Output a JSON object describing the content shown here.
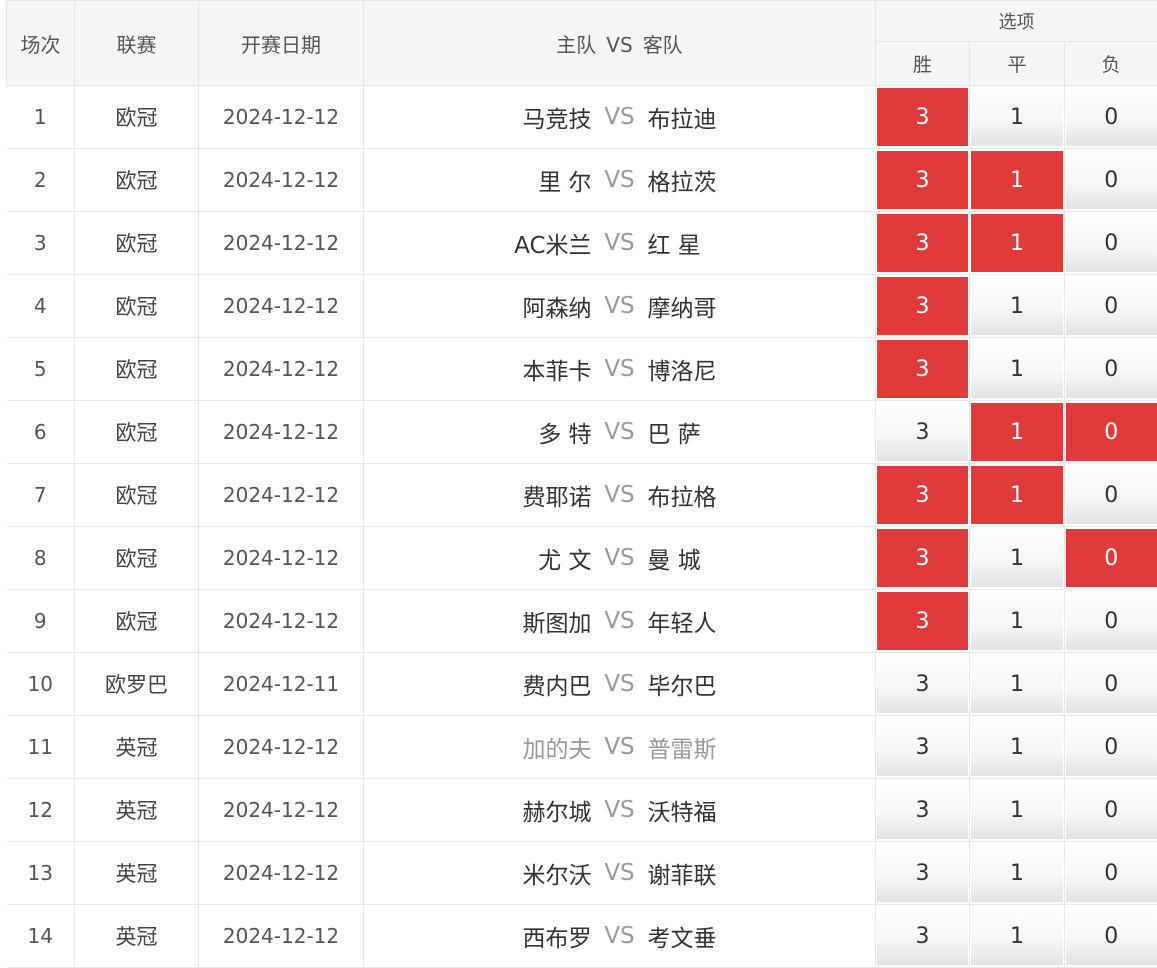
{
  "headers": {
    "no": "场次",
    "league": "联赛",
    "date": "开赛日期",
    "home": "主队",
    "vs": "VS",
    "away": "客队",
    "options": "选项",
    "win": "胜",
    "draw": "平",
    "lose": "负"
  },
  "colors": {
    "selected": "#e03a3a",
    "muted": "#999999"
  },
  "rows": [
    {
      "no": "1",
      "league": "欧冠",
      "date": "2024-12-12",
      "home": "马竞技",
      "vs": "VS",
      "away": "布拉迪",
      "win": "3",
      "draw": "1",
      "lose": "0",
      "sel": [
        true,
        false,
        false
      ],
      "dim": false
    },
    {
      "no": "2",
      "league": "欧冠",
      "date": "2024-12-12",
      "home": "里 尔",
      "vs": "VS",
      "away": "格拉茨",
      "win": "3",
      "draw": "1",
      "lose": "0",
      "sel": [
        true,
        true,
        false
      ],
      "dim": false
    },
    {
      "no": "3",
      "league": "欧冠",
      "date": "2024-12-12",
      "home": "AC米兰",
      "vs": "VS",
      "away": "红 星",
      "win": "3",
      "draw": "1",
      "lose": "0",
      "sel": [
        true,
        true,
        false
      ],
      "dim": false
    },
    {
      "no": "4",
      "league": "欧冠",
      "date": "2024-12-12",
      "home": "阿森纳",
      "vs": "VS",
      "away": "摩纳哥",
      "win": "3",
      "draw": "1",
      "lose": "0",
      "sel": [
        true,
        false,
        false
      ],
      "dim": false
    },
    {
      "no": "5",
      "league": "欧冠",
      "date": "2024-12-12",
      "home": "本菲卡",
      "vs": "VS",
      "away": "博洛尼",
      "win": "3",
      "draw": "1",
      "lose": "0",
      "sel": [
        true,
        false,
        false
      ],
      "dim": false
    },
    {
      "no": "6",
      "league": "欧冠",
      "date": "2024-12-12",
      "home": "多 特",
      "vs": "VS",
      "away": "巴 萨",
      "win": "3",
      "draw": "1",
      "lose": "0",
      "sel": [
        false,
        true,
        true
      ],
      "dim": false
    },
    {
      "no": "7",
      "league": "欧冠",
      "date": "2024-12-12",
      "home": "费耶诺",
      "vs": "VS",
      "away": "布拉格",
      "win": "3",
      "draw": "1",
      "lose": "0",
      "sel": [
        true,
        true,
        false
      ],
      "dim": false
    },
    {
      "no": "8",
      "league": "欧冠",
      "date": "2024-12-12",
      "home": "尤 文",
      "vs": "VS",
      "away": "曼 城",
      "win": "3",
      "draw": "1",
      "lose": "0",
      "sel": [
        true,
        false,
        true
      ],
      "dim": false
    },
    {
      "no": "9",
      "league": "欧冠",
      "date": "2024-12-12",
      "home": "斯图加",
      "vs": "VS",
      "away": "年轻人",
      "win": "3",
      "draw": "1",
      "lose": "0",
      "sel": [
        true,
        false,
        false
      ],
      "dim": false
    },
    {
      "no": "10",
      "league": "欧罗巴",
      "date": "2024-12-11",
      "home": "费内巴",
      "vs": "VS",
      "away": "毕尔巴",
      "win": "3",
      "draw": "1",
      "lose": "0",
      "sel": [
        false,
        false,
        false
      ],
      "dim": false
    },
    {
      "no": "11",
      "league": "英冠",
      "date": "2024-12-12",
      "home": "加的夫",
      "vs": "VS",
      "away": "普雷斯",
      "win": "3",
      "draw": "1",
      "lose": "0",
      "sel": [
        false,
        false,
        false
      ],
      "dim": true
    },
    {
      "no": "12",
      "league": "英冠",
      "date": "2024-12-12",
      "home": "赫尔城",
      "vs": "VS",
      "away": "沃特福",
      "win": "3",
      "draw": "1",
      "lose": "0",
      "sel": [
        false,
        false,
        false
      ],
      "dim": false
    },
    {
      "no": "13",
      "league": "英冠",
      "date": "2024-12-12",
      "home": "米尔沃",
      "vs": "VS",
      "away": "谢菲联",
      "win": "3",
      "draw": "1",
      "lose": "0",
      "sel": [
        false,
        false,
        false
      ],
      "dim": false
    },
    {
      "no": "14",
      "league": "英冠",
      "date": "2024-12-12",
      "home": "西布罗",
      "vs": "VS",
      "away": "考文垂",
      "win": "3",
      "draw": "1",
      "lose": "0",
      "sel": [
        false,
        false,
        false
      ],
      "dim": false
    }
  ]
}
